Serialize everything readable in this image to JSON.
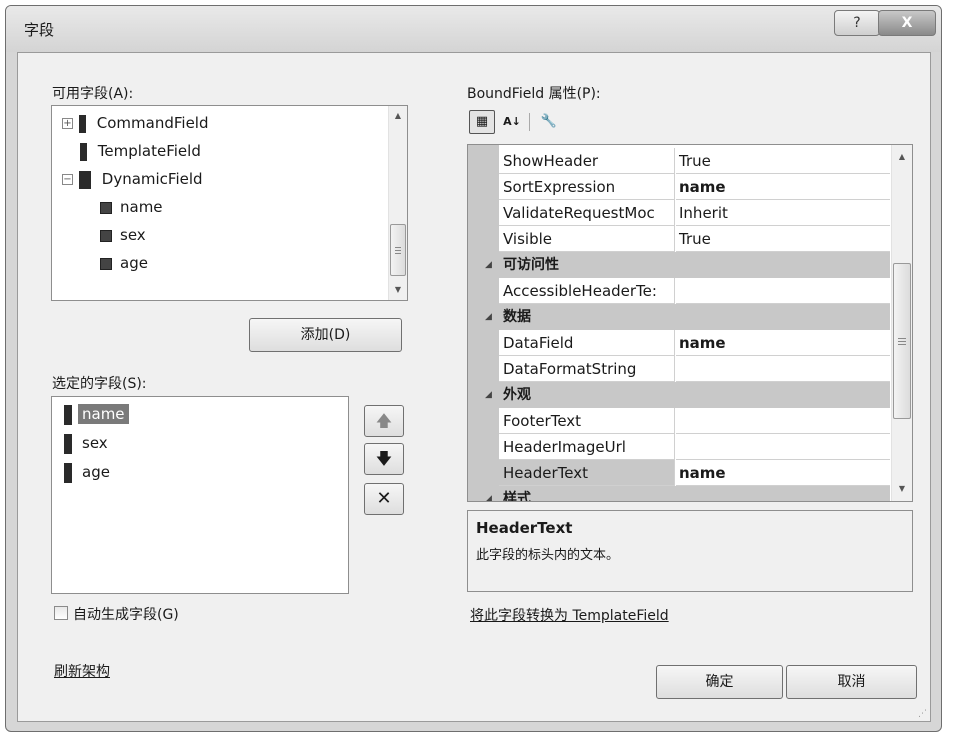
{
  "window": {
    "title": "字段",
    "help_glyph": "?",
    "close_glyph": "X"
  },
  "available": {
    "label": "可用字段(A):",
    "items": [
      {
        "label": "CommandField",
        "expander": "+"
      },
      {
        "label": "TemplateField",
        "expander": ""
      },
      {
        "label": "DynamicField",
        "expander": "−"
      },
      {
        "label": "name"
      },
      {
        "label": "sex"
      },
      {
        "label": "age"
      }
    ],
    "add_button": "添加(D)"
  },
  "selected": {
    "label": "选定的字段(S):",
    "items": [
      "name",
      "sex",
      "age"
    ],
    "selected_index": 0,
    "up_glyph": "🡅",
    "down_glyph": "🡇",
    "delete_glyph": "✕"
  },
  "auto_generate": {
    "label": "自动生成字段(G)",
    "checked": false
  },
  "refresh_link": "刷新架构",
  "properties": {
    "label": "BoundField 属性(P):",
    "toolbar": {
      "categorized_glyph": "▦",
      "alpha_sort_glyph": "A↓",
      "property_pages_glyph": "🔧"
    },
    "rows": [
      {
        "name": "ShowHeader",
        "value": "True",
        "bold": false
      },
      {
        "name": "SortExpression",
        "value": "name",
        "bold": true
      },
      {
        "name": "ValidateRequestMoc",
        "value": "Inherit",
        "bold": false
      },
      {
        "name": "Visible",
        "value": "True",
        "bold": false
      }
    ],
    "cat_access": {
      "label": "可访问性",
      "rows": [
        {
          "name": "AccessibleHeaderTe:",
          "value": ""
        }
      ]
    },
    "cat_data": {
      "label": "数据",
      "rows": [
        {
          "name": "DataField",
          "value": "name",
          "bold": true
        },
        {
          "name": "DataFormatString",
          "value": ""
        }
      ]
    },
    "cat_appearance": {
      "label": "外观",
      "rows": [
        {
          "name": "FooterText",
          "value": ""
        },
        {
          "name": "HeaderImageUrl",
          "value": ""
        },
        {
          "name": "HeaderText",
          "value": "name",
          "bold": true
        }
      ]
    },
    "cat_style": {
      "label": "样式"
    },
    "description": {
      "title": "HeaderText",
      "text": "此字段的标头内的文本。"
    },
    "convert_link": "将此字段转换为 TemplateField"
  },
  "buttons": {
    "ok": "确定",
    "cancel": "取消"
  },
  "colors": {
    "selection": "#7a7a7a",
    "category_bg": "#c8c8c8",
    "dialog_bg": "#f0f0f0"
  }
}
